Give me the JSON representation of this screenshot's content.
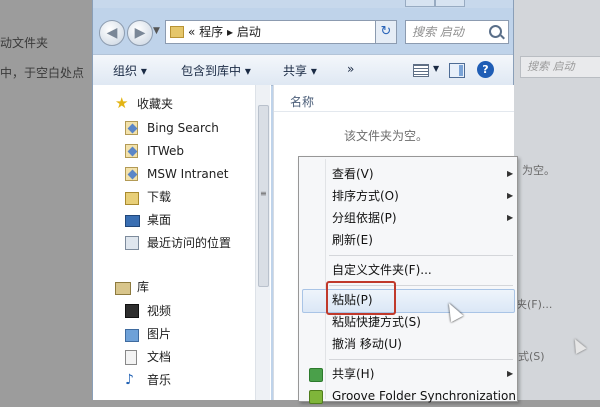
{
  "background": {
    "doc_lines": [
      "动文件夹",
      "中，于空白处点"
    ],
    "right_window": {
      "search_placeholder": "搜索 启动",
      "labels": [
        "为空。",
        "夹(F)...",
        "式(S)"
      ]
    }
  },
  "window": {
    "address": {
      "breadcrumb_prefix": "«",
      "crumb1": "程序",
      "sep": "▸",
      "crumb2": "启动"
    },
    "search_placeholder": "搜索 启动",
    "toolbar": {
      "organize": "组织 ▾",
      "include_library": "包含到库中 ▾",
      "share": "共享 ▾",
      "more": "»"
    },
    "sidebar": {
      "favorites": "收藏夹",
      "items": [
        "Bing Search",
        "ITWeb",
        "MSW Intranet",
        "下载",
        "桌面",
        "最近访问的位置"
      ],
      "library": "库",
      "library_items": [
        "视频",
        "图片",
        "文档",
        "音乐"
      ]
    },
    "content": {
      "column_header": "名称",
      "empty_message": "该文件夹为空。"
    }
  },
  "context_menu": {
    "items": [
      {
        "label": "查看(V)",
        "submenu": true
      },
      {
        "label": "排序方式(O)",
        "submenu": true
      },
      {
        "label": "分组依据(P)",
        "submenu": true
      },
      {
        "label": "刷新(E)",
        "submenu": false
      },
      {
        "label": "自定义文件夹(F)...",
        "submenu": false
      },
      {
        "label": "粘贴(P)",
        "submenu": false,
        "highlighted": true
      },
      {
        "label": "粘贴快捷方式(S)",
        "submenu": false
      },
      {
        "label": "撤消 移动(U)",
        "submenu": false
      },
      {
        "label": "共享(H)",
        "submenu": true
      },
      {
        "label": "Groove Folder Synchronization",
        "submenu": true
      }
    ]
  },
  "colors": {
    "highlight_border": "#c0392b",
    "window_frame": "#bfd3ea"
  }
}
